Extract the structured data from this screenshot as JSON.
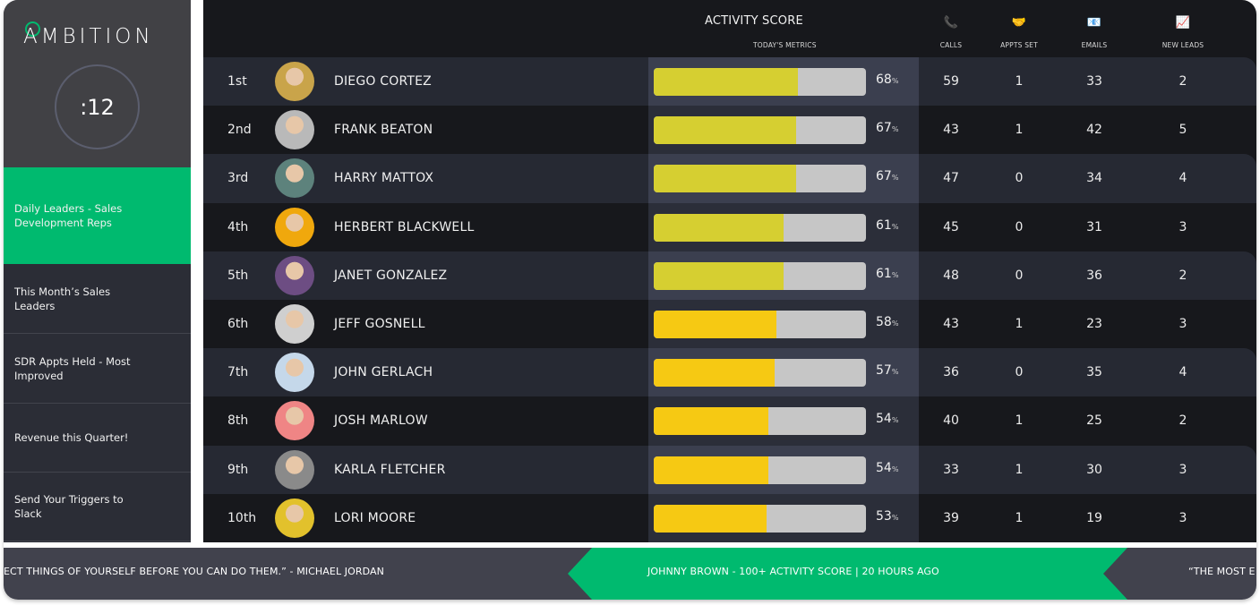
{
  "brand": {
    "logo_text": "AMBITION",
    "accent": "#00ba6f"
  },
  "timer": ":12",
  "sidebar": {
    "items": [
      {
        "label": "Daily Leaders - Sales Development Reps",
        "active": true
      },
      {
        "label": "This Month’s Sales Leaders",
        "active": false
      },
      {
        "label": "SDR Appts Held - Most Improved",
        "active": false
      },
      {
        "label": "Revenue this Quarter!",
        "active": false
      },
      {
        "label": "Send Your Triggers to Slack",
        "active": false
      }
    ]
  },
  "header": {
    "title": "ACTIVITY SCORE",
    "subtitle": "TODAY'S METRICS",
    "metrics": [
      {
        "label": "CALLS",
        "icon": "phone-icon",
        "glyph": "📞"
      },
      {
        "label": "APPTS SET",
        "icon": "handshake-icon",
        "glyph": "🤝"
      },
      {
        "label": "EMAILS",
        "icon": "email-icon",
        "glyph": "📧"
      },
      {
        "label": "NEW LEADS",
        "icon": "chart-increasing-icon",
        "glyph": "📈"
      }
    ]
  },
  "colors": {
    "bar_high": "#d6cf31",
    "bar_mid": "#f6c913",
    "bar_track": "#c6c6c6"
  },
  "leaders": [
    {
      "rank": "1st",
      "name": "DIEGO CORTEZ",
      "score": 68,
      "calls": 59,
      "appts": 1,
      "emails": 33,
      "leads": 2,
      "avatar_bg": "#c9a44a",
      "tier": "high"
    },
    {
      "rank": "2nd",
      "name": "FRANK BEATON",
      "score": 67,
      "calls": 43,
      "appts": 1,
      "emails": 42,
      "leads": 5,
      "avatar_bg": "#b9b9b9",
      "tier": "high"
    },
    {
      "rank": "3rd",
      "name": "HARRY MATTOX",
      "score": 67,
      "calls": 47,
      "appts": 0,
      "emails": 34,
      "leads": 4,
      "avatar_bg": "#5d827c",
      "tier": "high"
    },
    {
      "rank": "4th",
      "name": "HERBERT BLACKWELL",
      "score": 61,
      "calls": 45,
      "appts": 0,
      "emails": 31,
      "leads": 3,
      "avatar_bg": "#f0a80d",
      "tier": "high"
    },
    {
      "rank": "5th",
      "name": "JANET GONZALEZ",
      "score": 61,
      "calls": 48,
      "appts": 0,
      "emails": 36,
      "leads": 2,
      "avatar_bg": "#6d4d83",
      "tier": "high"
    },
    {
      "rank": "6th",
      "name": "JEFF GOSNELL",
      "score": 58,
      "calls": 43,
      "appts": 1,
      "emails": 23,
      "leads": 3,
      "avatar_bg": "#cfcfcf",
      "tier": "mid"
    },
    {
      "rank": "7th",
      "name": "JOHN GERLACH",
      "score": 57,
      "calls": 36,
      "appts": 0,
      "emails": 35,
      "leads": 4,
      "avatar_bg": "#c5d8ea",
      "tier": "mid"
    },
    {
      "rank": "8th",
      "name": "JOSH MARLOW",
      "score": 54,
      "calls": 40,
      "appts": 1,
      "emails": 25,
      "leads": 2,
      "avatar_bg": "#ef8585",
      "tier": "mid"
    },
    {
      "rank": "9th",
      "name": "KARLA FLETCHER",
      "score": 54,
      "calls": 33,
      "appts": 1,
      "emails": 30,
      "leads": 3,
      "avatar_bg": "#8a8a8a",
      "tier": "mid"
    },
    {
      "rank": "10th",
      "name": "LORI MOORE",
      "score": 53,
      "calls": 39,
      "appts": 1,
      "emails": 19,
      "leads": 3,
      "avatar_bg": "#e2c12c",
      "tier": "mid"
    }
  ],
  "ticker": {
    "left": "ECT THINGS OF YOURSELF BEFORE YOU CAN DO THEM.” - MICHAEL JORDAN",
    "center": "JOHNNY BROWN - 100+ ACTIVITY SCORE | 20 HOURS AGO",
    "right": "“THE MOST E"
  }
}
